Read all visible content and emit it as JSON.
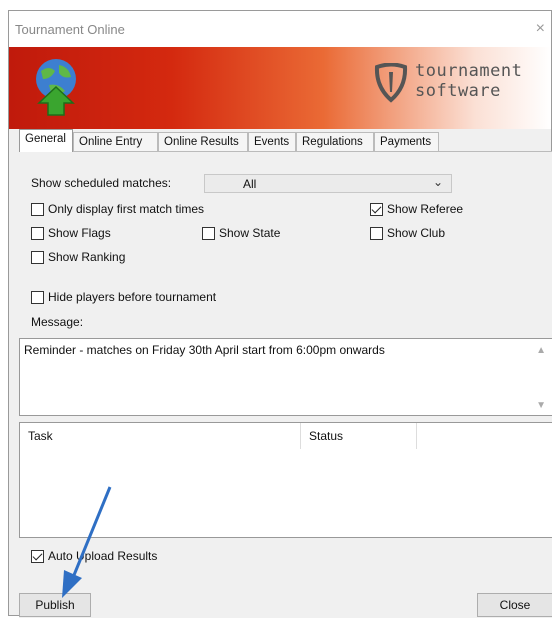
{
  "window": {
    "title": "Tournament Online",
    "close_glyph": "×"
  },
  "banner": {
    "logo_line1": "tournament",
    "logo_line2": "software"
  },
  "tabs": [
    "General",
    "Online Entry",
    "Online Results",
    "Events",
    "Regulations",
    "Payments"
  ],
  "general": {
    "scheduled_label": "Show scheduled matches:",
    "scheduled_value": "All",
    "options": {
      "first_match": {
        "label": "Only display first match times",
        "checked": false
      },
      "show_referee": {
        "label": "Show Referee",
        "checked": true
      },
      "show_flags": {
        "label": "Show Flags",
        "checked": false
      },
      "show_state": {
        "label": "Show State",
        "checked": false
      },
      "show_club": {
        "label": "Show Club",
        "checked": false
      },
      "show_ranking": {
        "label": "Show Ranking",
        "checked": false
      },
      "hide_players": {
        "label": "Hide players before tournament",
        "checked": false
      }
    },
    "message_label": "Message:",
    "message_text": "Reminder - matches on Friday 30th April start from 6:00pm onwards"
  },
  "task_table": {
    "columns": [
      "Task",
      "Status",
      ""
    ]
  },
  "auto_upload": {
    "label": "Auto Upload Results",
    "checked": true
  },
  "buttons": {
    "publish": "Publish",
    "close": "Close"
  },
  "colors": {
    "banner_red": "#c01a0c",
    "annotation_arrow": "#2f6fc4",
    "globe_green": "#3aa52f"
  },
  "icons": [
    "globe-upload-icon",
    "shield-logo-icon",
    "close-icon",
    "dropdown-arrow-icon",
    "scroll-up-icon",
    "scroll-down-icon"
  ]
}
